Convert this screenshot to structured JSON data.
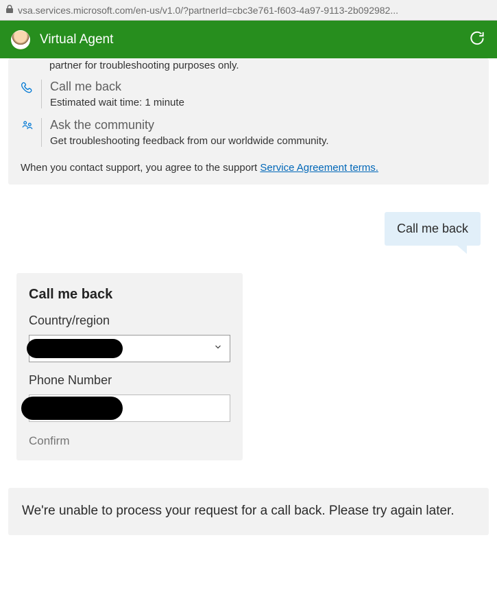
{
  "address_bar": {
    "url": "vsa.services.microsoft.com/en-us/v1.0/?partnerId=cbc3e761-f603-4a97-9113-2b092982..."
  },
  "header": {
    "title": "Virtual Agent"
  },
  "support_card": {
    "partial_text": "partner for troubleshooting purposes only.",
    "options": [
      {
        "icon": "phone",
        "title": "Call me back",
        "sub": "Estimated wait time: 1 minute"
      },
      {
        "icon": "community",
        "title": "Ask the community",
        "sub": "Get troubleshooting feedback from our worldwide community."
      }
    ],
    "agreement_prefix": "When you contact support, you agree to the support ",
    "agreement_link": "Service Agreement terms."
  },
  "user_message": "Call me back",
  "form": {
    "title": "Call me back",
    "country_label": "Country/region",
    "country_value": "[redacted]",
    "phone_label": "Phone Number",
    "phone_value": "[redacted]",
    "confirm_label": "Confirm"
  },
  "error_message": "We're unable to process your request for a call back. Please try again later."
}
